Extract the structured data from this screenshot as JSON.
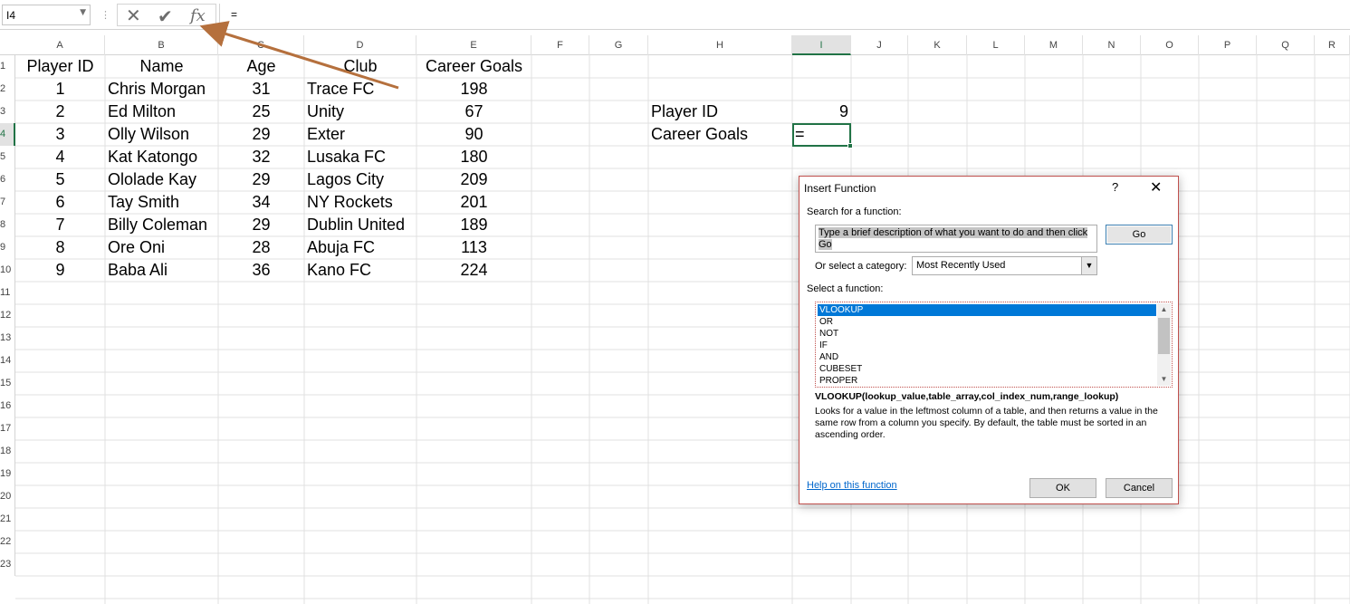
{
  "formula_bar": {
    "name_box": "I4",
    "formula": "=",
    "cancel_icon": "close-x-icon",
    "enter_icon": "checkmark-icon",
    "fx_label": "fx"
  },
  "columns": [
    "A",
    "B",
    "C",
    "D",
    "E",
    "F",
    "G",
    "H",
    "I",
    "J",
    "K",
    "L",
    "M",
    "N",
    "O",
    "P",
    "Q",
    "R"
  ],
  "selected_column": "I",
  "rows": [
    "1",
    "2",
    "3",
    "4",
    "5",
    "6",
    "7",
    "8",
    "9",
    "10",
    "11",
    "12",
    "13",
    "14",
    "15",
    "16",
    "17",
    "18",
    "19",
    "20",
    "21",
    "22",
    "23"
  ],
  "selected_row": "4",
  "table": {
    "headers": [
      "Player ID",
      "Name",
      "Age",
      "Club",
      "Career Goals"
    ],
    "rows": [
      [
        "1",
        "Chris Morgan",
        "31",
        "Trace FC",
        "198"
      ],
      [
        "2",
        "Ed Milton",
        "25",
        "Unity",
        "67"
      ],
      [
        "3",
        "Olly Wilson",
        "29",
        "Exter",
        "90"
      ],
      [
        "4",
        "Kat Katongo",
        "32",
        "Lusaka FC",
        "180"
      ],
      [
        "5",
        "Ololade Kay",
        "29",
        "Lagos City",
        "209"
      ],
      [
        "6",
        "Tay Smith",
        "34",
        "NY Rockets",
        "201"
      ],
      [
        "7",
        "Billy Coleman",
        "29",
        "Dublin United",
        "189"
      ],
      [
        "8",
        "Ore Oni",
        "28",
        "Abuja FC",
        "113"
      ],
      [
        "9",
        "Baba Ali",
        "36",
        "Kano FC",
        "224"
      ]
    ]
  },
  "lookup": {
    "id_label": "Player ID",
    "id_value": "9",
    "goals_label": "Career Goals",
    "goals_value": "="
  },
  "dialog": {
    "title": "Insert Function",
    "help": "?",
    "close": "✕",
    "search_label": "Search for a function:",
    "search_value": "Type a brief description of what you want to do and then click Go",
    "go": "Go",
    "category_label": "Or select a category:",
    "category_value": "Most Recently Used",
    "select_label": "Select a function:",
    "functions": [
      "VLOOKUP",
      "OR",
      "NOT",
      "IF",
      "AND",
      "CUBESET",
      "PROPER"
    ],
    "selected_function": "VLOOKUP",
    "syntax": "VLOOKUP(lookup_value,table_array,col_index_num,range_lookup)",
    "description": "Looks for a value in the leftmost column of a table, and then returns a value in the same row from a column you specify. By default, the table must be sorted in an ascending order.",
    "help_link": "Help on this function",
    "ok": "OK",
    "cancel": "Cancel"
  },
  "colors": {
    "accent": "#217346",
    "annotation_arrow": "#b5703d",
    "dialog_border": "#c0504d",
    "selection": "#0078d7"
  }
}
